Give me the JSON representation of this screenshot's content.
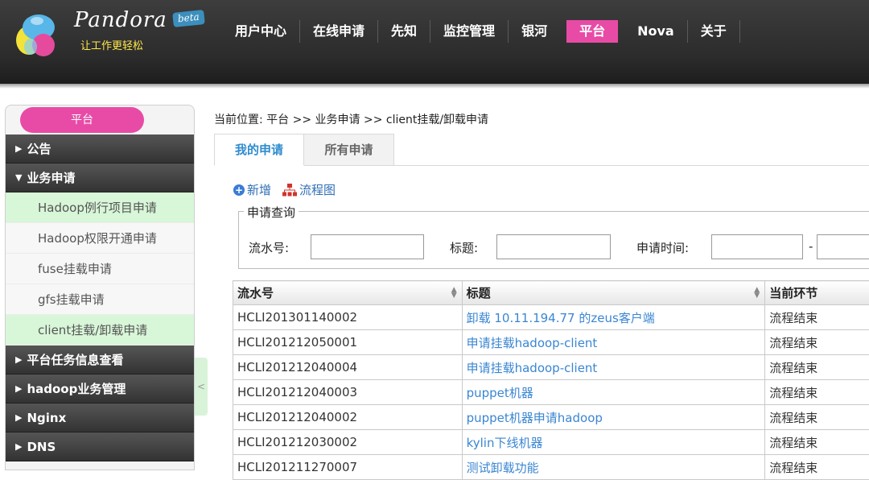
{
  "brand": {
    "name": "Pandora",
    "slogan": "让工作更轻松",
    "badge": "beta"
  },
  "nav": [
    {
      "label": "用户中心",
      "active": false
    },
    {
      "label": "在线申请",
      "active": false
    },
    {
      "label": "先知",
      "active": false
    },
    {
      "label": "监控管理",
      "active": false
    },
    {
      "label": "银河",
      "active": false
    },
    {
      "label": "平台",
      "active": true
    },
    {
      "label": "Nova",
      "active": false
    },
    {
      "label": "关于",
      "active": false
    }
  ],
  "sidebar": {
    "title": "平台",
    "groups": [
      {
        "label": "公告",
        "arrow": "▶"
      },
      {
        "label": "业务申请",
        "arrow": "▼"
      }
    ],
    "sub_items": [
      {
        "label": "Hadoop例行项目申请",
        "highlight": true
      },
      {
        "label": "Hadoop权限开通申请",
        "highlight": false
      },
      {
        "label": "fuse挂载申请",
        "highlight": false
      },
      {
        "label": "gfs挂载申请",
        "highlight": false
      },
      {
        "label": "client挂载/卸载申请",
        "highlight": true
      }
    ],
    "more_groups": [
      {
        "label": "平台任务信息查看",
        "arrow": "▶"
      },
      {
        "label": "hadoop业务管理",
        "arrow": "▶"
      },
      {
        "label": "Nginx",
        "arrow": "▶"
      },
      {
        "label": "DNS",
        "arrow": "▶"
      }
    ],
    "collapse_glyph": "<"
  },
  "breadcrumb": "当前位置: 平台 >> 业务申请 >> client挂载/卸载申请",
  "tabs": [
    {
      "label": "我的申请",
      "active": true
    },
    {
      "label": "所有申请",
      "active": false
    }
  ],
  "toolbar": {
    "add_label": "新增",
    "flow_label": "流程图"
  },
  "query": {
    "legend": "申请查询",
    "serial_label": "流水号:",
    "title_label": "标题:",
    "time_label": "申请时间:",
    "range_sep": "-"
  },
  "table": {
    "headers": [
      "流水号",
      "标题",
      "当前环节"
    ],
    "rows": [
      {
        "serial": "HCLI201301140002",
        "title": "卸载 10.11.194.77 的zeus客户端",
        "stage": "流程结束"
      },
      {
        "serial": "HCLI201212050001",
        "title": "申请挂载hadoop-client",
        "stage": "流程结束"
      },
      {
        "serial": "HCLI201212040004",
        "title": "申请挂载hadoop-client",
        "stage": "流程结束"
      },
      {
        "serial": "HCLI201212040003",
        "title": "puppet机器",
        "stage": "流程结束"
      },
      {
        "serial": "HCLI201212040002",
        "title": "puppet机器申请hadoop",
        "stage": "流程结束"
      },
      {
        "serial": "HCLI201212030002",
        "title": "kylin下线机器",
        "stage": "流程结束"
      },
      {
        "serial": "HCLI201211270007",
        "title": "测试卸载功能",
        "stage": "流程结束"
      }
    ]
  },
  "colors": {
    "accent_pink": "#e84ba6",
    "link_blue": "#3a86d2",
    "highlight_green": "#d8f6d8"
  }
}
